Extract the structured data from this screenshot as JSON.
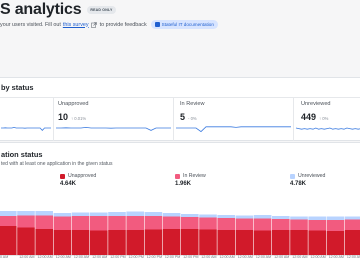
{
  "header": {
    "title": "S analytics",
    "readonly_badge": "READ ONLY",
    "subtitle_prefix": "your users visited.  Fill out",
    "subtitle_link": "this survey",
    "subtitle_suffix": "to provide feedback",
    "docs_button": "Stateful IT documentation"
  },
  "status_card": {
    "title": "by status",
    "stats": [
      {
        "label": "Unapproved",
        "value": "10",
        "change": "↑ 0.01%"
      },
      {
        "label": "In Review",
        "value": "5",
        "change": "- 0%"
      },
      {
        "label": "Unreviewed",
        "value": "449",
        "change": "↑ 0%"
      }
    ]
  },
  "distribution_card": {
    "title": "ation status",
    "description": "ted with at least one application in the given status",
    "legend": [
      {
        "label": "Unapproved",
        "value": "4.64K",
        "color": "#d11a2a"
      },
      {
        "label": "In Review",
        "value": "1.96K",
        "color": "#f25b7f"
      },
      {
        "label": "Unreviewed",
        "value": "4.78K",
        "color": "#b8d3ff"
      }
    ]
  },
  "chart_data": {
    "type": "bar",
    "stacked": true,
    "categories": [
      "0 AM",
      "12:00 AM",
      "12:00 AM",
      "12:00 AM",
      "12:00 AM",
      "12:00 AM",
      "12:00 PM",
      "12:00 PM",
      "12:00 PM",
      "12:00 PM",
      "12:00 PM",
      "12:00 AM",
      "12:00 AM",
      "12:00 AM",
      "12:00 AM",
      "12:00 AM",
      "12:00 AM",
      "12:00 AM",
      "12:00 AM",
      "12:00 AM"
    ],
    "series": [
      {
        "name": "Unapproved",
        "color": "#d11a2a",
        "values": [
          0.58,
          0.55,
          0.52,
          0.5,
          0.5,
          0.49,
          0.5,
          0.5,
          0.51,
          0.52,
          0.52,
          0.51,
          0.5,
          0.5,
          0.49,
          0.5,
          0.5,
          0.49,
          0.48,
          0.5
        ]
      },
      {
        "name": "In Review",
        "color": "#f25b7f",
        "values": [
          0.2,
          0.24,
          0.27,
          0.27,
          0.28,
          0.29,
          0.28,
          0.28,
          0.27,
          0.25,
          0.24,
          0.24,
          0.24,
          0.23,
          0.24,
          0.22,
          0.21,
          0.21,
          0.22,
          0.21
        ]
      },
      {
        "name": "Unreviewed",
        "color": "#b8d3ff",
        "values": [
          0.1,
          0.09,
          0.09,
          0.07,
          0.07,
          0.07,
          0.08,
          0.09,
          0.08,
          0.07,
          0.06,
          0.06,
          0.06,
          0.06,
          0.07,
          0.06,
          0.06,
          0.07,
          0.07,
          0.06
        ]
      }
    ],
    "ylim": [
      0,
      1
    ]
  },
  "sparklines": [
    {
      "name": "unapproved-trend",
      "values": [
        0.5,
        0.5,
        0.52,
        0.5,
        0.5,
        0.5,
        0.55,
        0.5,
        0.5,
        0.5,
        0.5,
        0.48,
        0.5,
        0.5,
        0.5,
        0.5,
        0.5,
        0.5,
        0.5,
        0.3,
        0.5,
        0.5,
        0.5,
        0.5
      ]
    },
    {
      "name": "in-review-trend",
      "values": [
        0.5,
        0.5,
        0.5,
        0.5,
        0.5,
        0.2,
        0.6,
        0.6,
        0.6,
        0.6,
        0.6,
        0.6,
        0.55,
        0.6,
        0.6,
        0.6,
        0.6,
        0.6,
        0.6,
        0.6,
        0.6,
        0.6,
        0.6,
        0.6
      ]
    },
    {
      "name": "unreviewed-trend",
      "values": [
        0.5,
        0.45,
        0.4,
        0.45,
        0.4,
        0.45,
        0.4,
        0.5,
        0.4,
        0.45,
        0.4,
        0.45,
        0.5,
        0.4,
        0.45,
        0.4,
        0.45,
        0.4,
        0.5,
        0.45,
        0.4,
        0.45,
        0.4,
        0.45
      ]
    }
  ]
}
